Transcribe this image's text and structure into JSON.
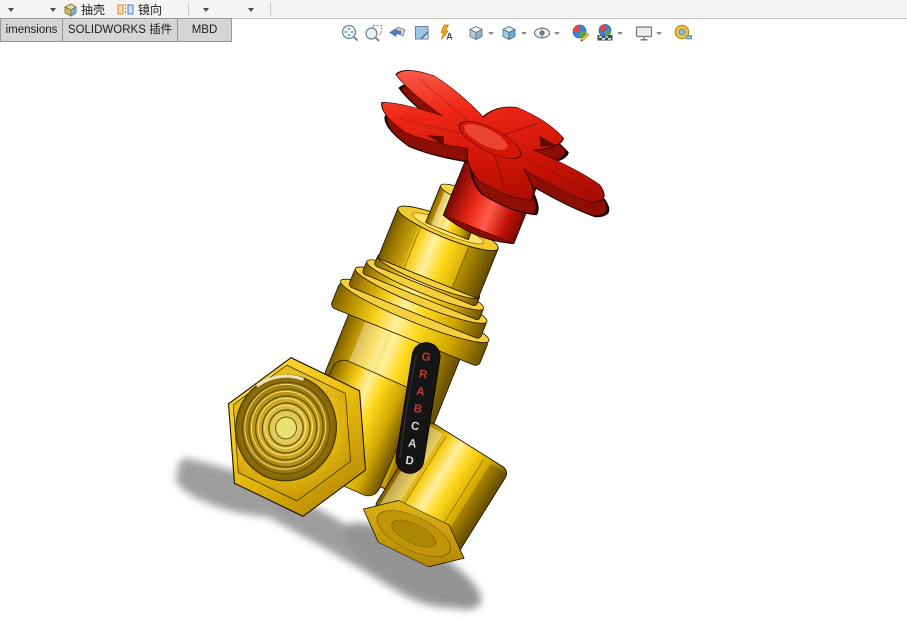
{
  "commandbar": {
    "shell_label": "抽壳",
    "mirror_label": "镜向"
  },
  "tabs": {
    "items": [
      {
        "label": "imensions"
      },
      {
        "label": "SOLIDWORKS 插件"
      },
      {
        "label": "MBD"
      }
    ]
  },
  "headsup": {
    "icons": [
      "zoom-to-fit",
      "zoom-to-area",
      "previous-view",
      "section-view",
      "dynamic-annotation-views",
      "view-orientation",
      "display-style",
      "hide-show-items",
      "edit-appearance",
      "apply-scene",
      "view-settings",
      "tape-measure"
    ]
  },
  "model": {
    "part": "gate-valve",
    "brand_letters": [
      "G",
      "R",
      "A",
      "B",
      "C",
      "A",
      "D"
    ],
    "colors": {
      "body_gold": "#F2BE00",
      "body_gold_highlight": "#FFEC7A",
      "body_gold_shadow": "#7C5E00",
      "wheel_red": "#E01408",
      "wheel_red_dark": "#8C0E04",
      "label_black": "#1B1B1B",
      "label_letter_red": "#C23B2A",
      "label_letter_gray": "#D8D8D8",
      "shadow_gray": "#8E8E8E",
      "viewport_bg": "#FFFFFF"
    }
  }
}
